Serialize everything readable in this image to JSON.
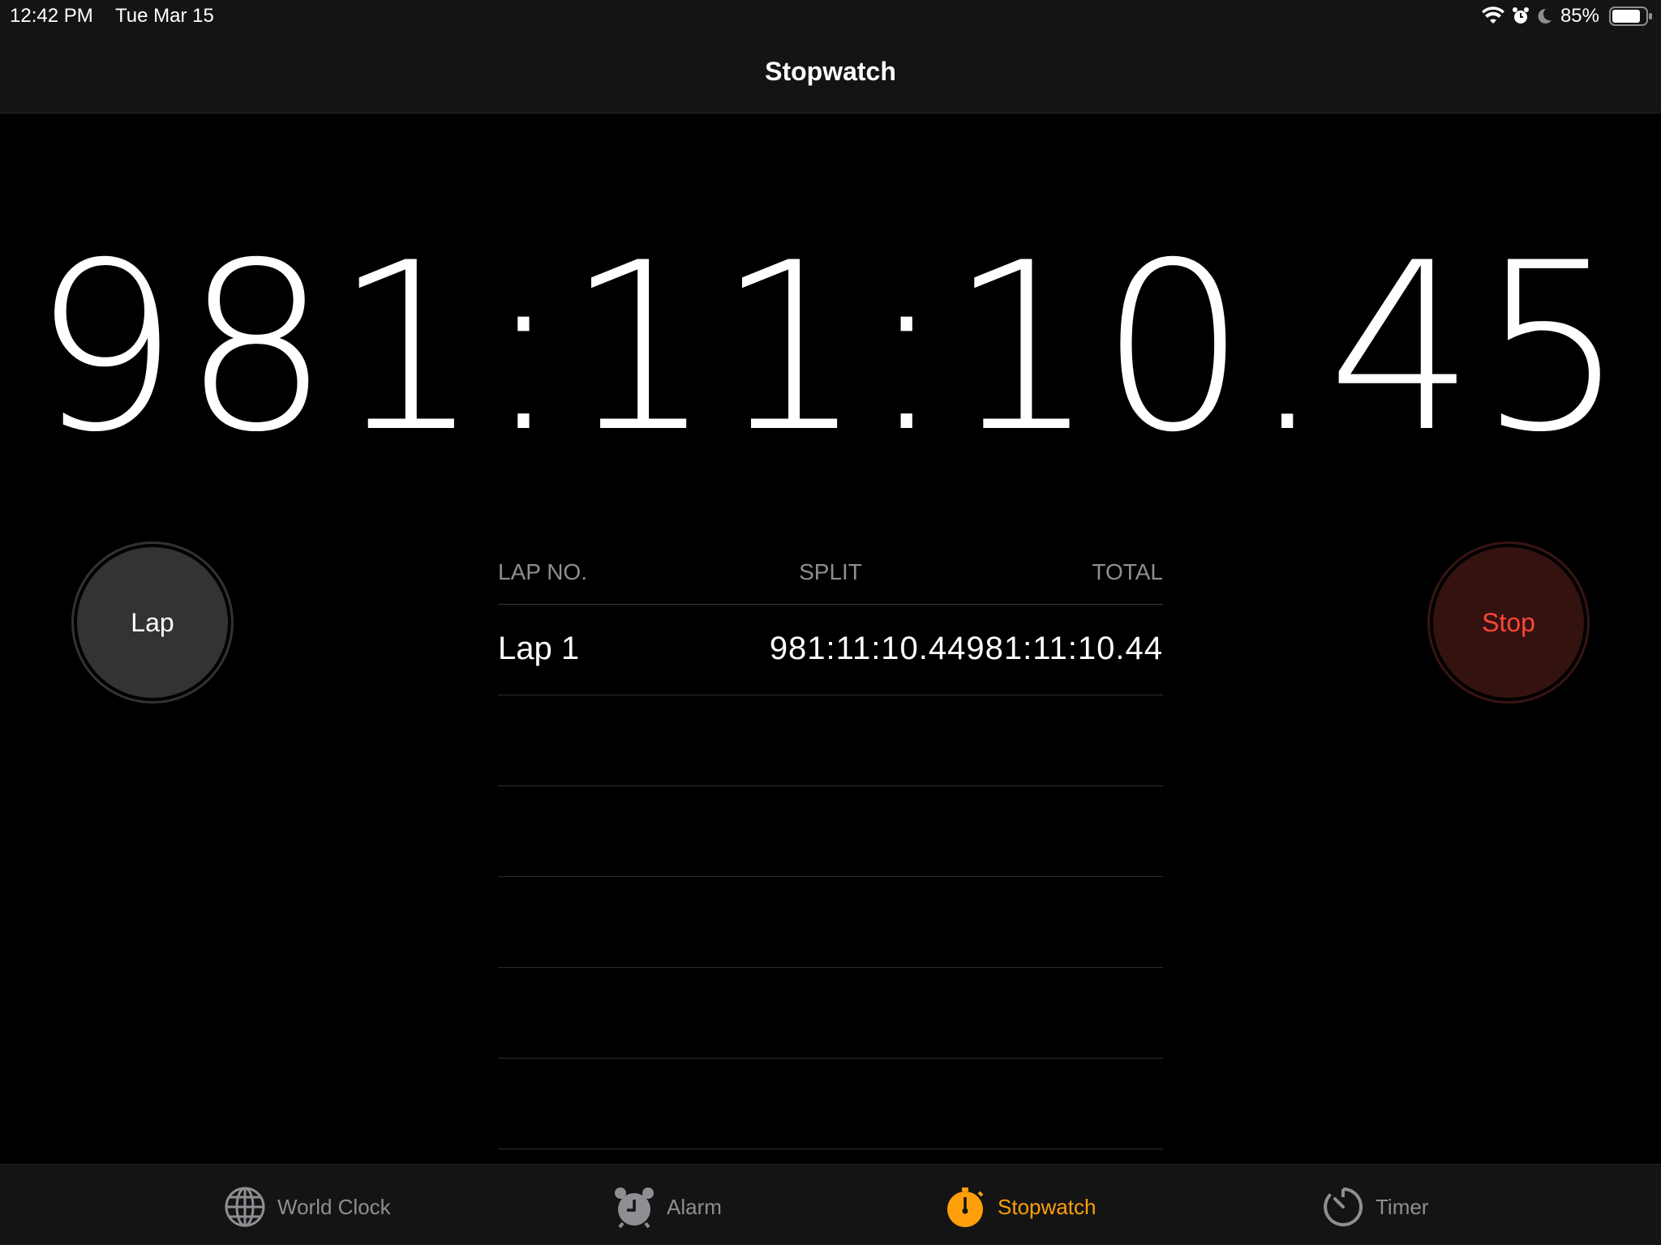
{
  "status_bar": {
    "time": "12:42 PM",
    "date": "Tue Mar 15",
    "battery_percent": "85%",
    "battery_level": 0.85,
    "icons": [
      "wifi-icon",
      "alarm-icon",
      "moon-icon",
      "battery-icon"
    ]
  },
  "nav": {
    "title": "Stopwatch"
  },
  "timer": {
    "display": "981:11:10.45"
  },
  "buttons": {
    "lap_label": "Lap",
    "stop_label": "Stop"
  },
  "lap_table": {
    "headers": {
      "lap_no": "LAP NO.",
      "split": "SPLIT",
      "total": "TOTAL"
    },
    "rows": [
      {
        "lap": "Lap 1",
        "split": "981:11:10.44",
        "total": "981:11:10.44"
      }
    ]
  },
  "tabs": [
    {
      "label": "World Clock",
      "icon": "globe-icon"
    },
    {
      "label": "Alarm",
      "icon": "alarm-clock-icon"
    },
    {
      "label": "Stopwatch",
      "icon": "stopwatch-icon",
      "selected": true
    },
    {
      "label": "Timer",
      "icon": "timer-icon"
    }
  ],
  "colors": {
    "background": "#000000",
    "bar_background": "#141414",
    "accent": "#ff9f0a",
    "stop_text": "#ff453a",
    "stop_bg": "#331210",
    "lap_bg": "#333333",
    "muted_text": "#8e8e93"
  }
}
